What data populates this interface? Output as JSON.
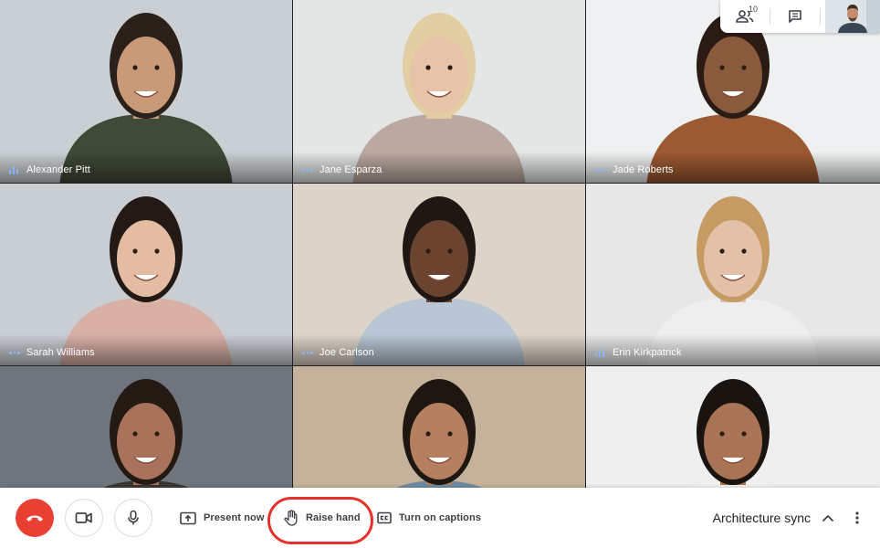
{
  "participants": [
    {
      "name": "Alexander Pitt",
      "indicator": "speaking",
      "bg": "#c9cfd2",
      "skin": "#c99a78",
      "hair": "#2b2019",
      "shirt": "#3f4a37"
    },
    {
      "name": "Jane Esparza",
      "indicator": "muted",
      "bg": "#e4e6e6",
      "skin": "#e7c3a7",
      "hair": "#e3cda2",
      "shirt": "#bba9a1"
    },
    {
      "name": "Jade Roberts",
      "indicator": "muted",
      "bg": "#eef0f1",
      "skin": "#8a5a3c",
      "hair": "#2a1c14",
      "shirt": "#9b5a32"
    },
    {
      "name": "Sarah Williams",
      "indicator": "muted",
      "bg": "#c9ced3",
      "skin": "#e4bca2",
      "hair": "#231915",
      "shirt": "#d8b0a6"
    },
    {
      "name": "Joe Carlson",
      "indicator": "muted",
      "bg": "#dcd4c8",
      "skin": "#6b4430",
      "hair": "#1f1713",
      "shirt": "#b9c6d4"
    },
    {
      "name": "Erin Kirkpatrick",
      "indicator": "speaking",
      "bg": "#e6e7e6",
      "skin": "#e3c1a8",
      "hair": "#c69a63",
      "shirt": "#eeeeee"
    },
    {
      "name": "",
      "indicator": "",
      "bg": "#6e757d",
      "skin": "#a8735a",
      "hair": "#251a13",
      "shirt": "#3c3630"
    },
    {
      "name": "",
      "indicator": "",
      "bg": "#c4b29a",
      "skin": "#b5805f",
      "hair": "#1e1711",
      "shirt": "#6e8aa3"
    },
    {
      "name": "",
      "indicator": "",
      "bg": "#efefef",
      "skin": "#a97456",
      "hair": "#1a1410",
      "shirt": "#f1f1f1"
    }
  ],
  "top_panel": {
    "people_count": "10",
    "people_icon": "people-icon",
    "chat_icon": "chat-icon"
  },
  "controls": {
    "end_call_icon": "end-call-icon",
    "camera_icon": "video-camera-icon",
    "mic_icon": "microphone-icon",
    "present_label": "Present now",
    "raise_hand_label": "Raise hand",
    "captions_label": "Turn on captions",
    "meeting_name": "Architecture sync",
    "chevron_icon": "chevron-up-icon",
    "more_icon": "more-vert-icon"
  },
  "colors": {
    "end_call": "#e84134",
    "highlight": "#e5312a",
    "indicator": "#8ab4f8"
  }
}
